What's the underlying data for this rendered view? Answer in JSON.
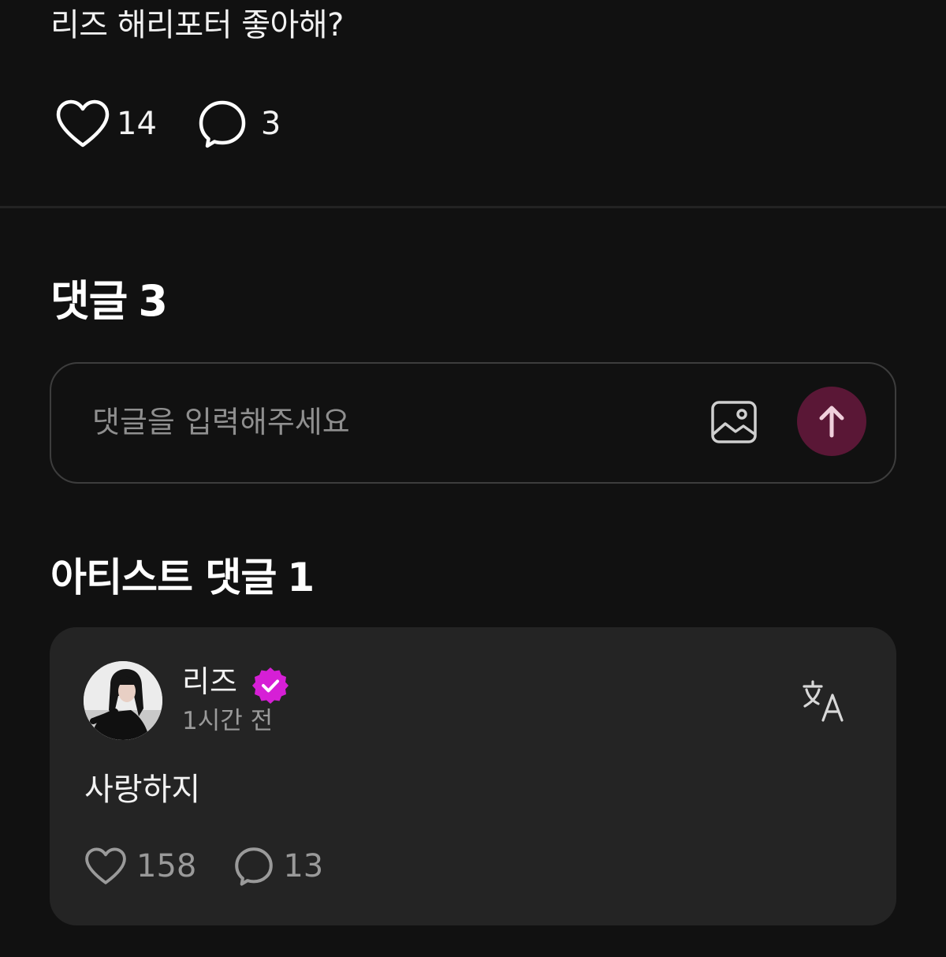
{
  "post": {
    "text": "리즈 해리포터 좋아해?",
    "likes": "14",
    "comments": "3"
  },
  "comments_section": {
    "title": "댓글",
    "count": "3"
  },
  "comment_input": {
    "placeholder": "댓글을 입력해주세요"
  },
  "artist_section": {
    "title": "아티스트 댓글",
    "count": "1"
  },
  "artist_comment": {
    "author": "리즈",
    "time": "1시간 전",
    "text": "사랑하지",
    "likes": "158",
    "replies": "13"
  },
  "colors": {
    "background": "#111111",
    "card": "#242424",
    "send_button": "#5a1736",
    "verified_badge": "#d61fd6"
  },
  "icons": {
    "like": "heart-icon",
    "comment": "speech-bubble-icon",
    "image": "image-icon",
    "send": "arrow-up-icon",
    "verified": "verified-badge-icon",
    "translate": "translate-icon"
  }
}
